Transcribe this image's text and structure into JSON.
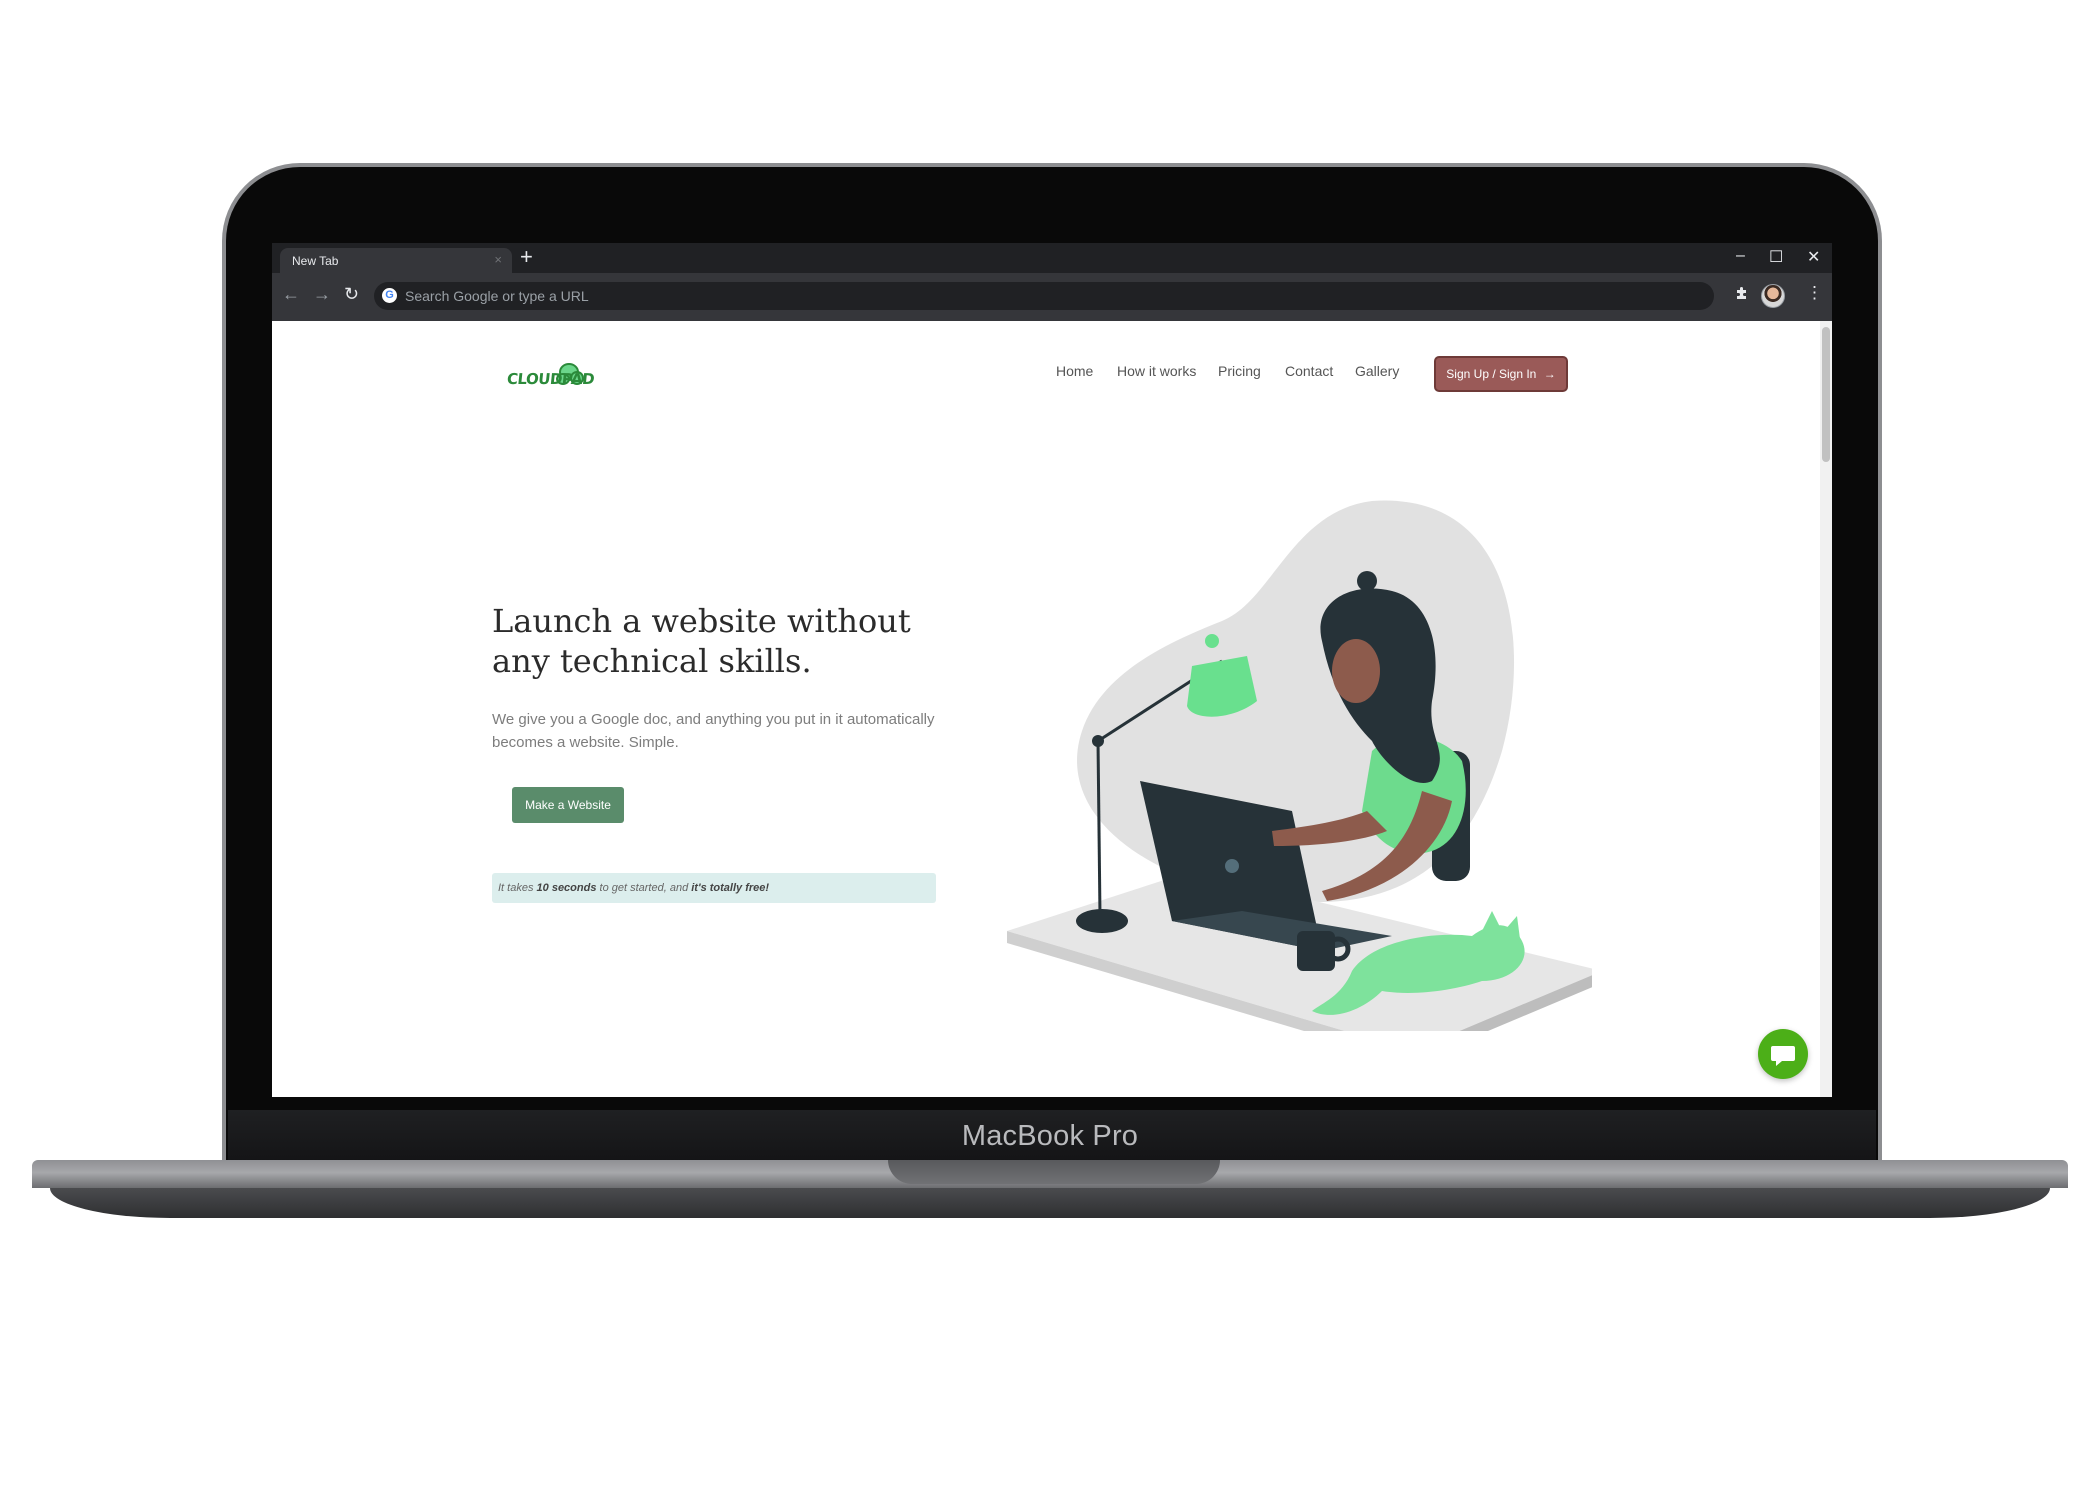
{
  "device": {
    "label": "MacBook Pro"
  },
  "browser": {
    "tab_title": "New Tab",
    "tab_close_icon": "×",
    "new_tab_icon": "+",
    "window_controls": {
      "minimize": "–",
      "maximize": "☐",
      "close": "✕"
    },
    "nav": {
      "back": "←",
      "forward": "→",
      "reload": "↻"
    },
    "omnibox_placeholder": "Search Google or type a URL",
    "extensions_icon": "puzzle",
    "menu_icon": "⋮"
  },
  "site": {
    "logo_text": "CLOUDPAD",
    "nav_links": [
      "Home",
      "How it works",
      "Pricing",
      "Contact",
      "Gallery"
    ],
    "cta_label": "Sign Up / Sign In",
    "cta_arrow": "→",
    "hero": {
      "title_line1": "Launch a website without",
      "title_line2": "any technical skills.",
      "description": "We give you a Google doc, and anything you put in it automatically becomes a website. Simple.",
      "button_label": "Make a Website"
    },
    "notice": {
      "prefix": "It takes ",
      "bold1": "10 seconds",
      "middle": " to get started, and ",
      "bold2": "it's totally free!"
    },
    "colors": {
      "brand_green": "#5a8c6b",
      "cta_brown": "#9a5a58",
      "chat_green": "#4caf18",
      "notice_bg": "#dceeed"
    }
  }
}
